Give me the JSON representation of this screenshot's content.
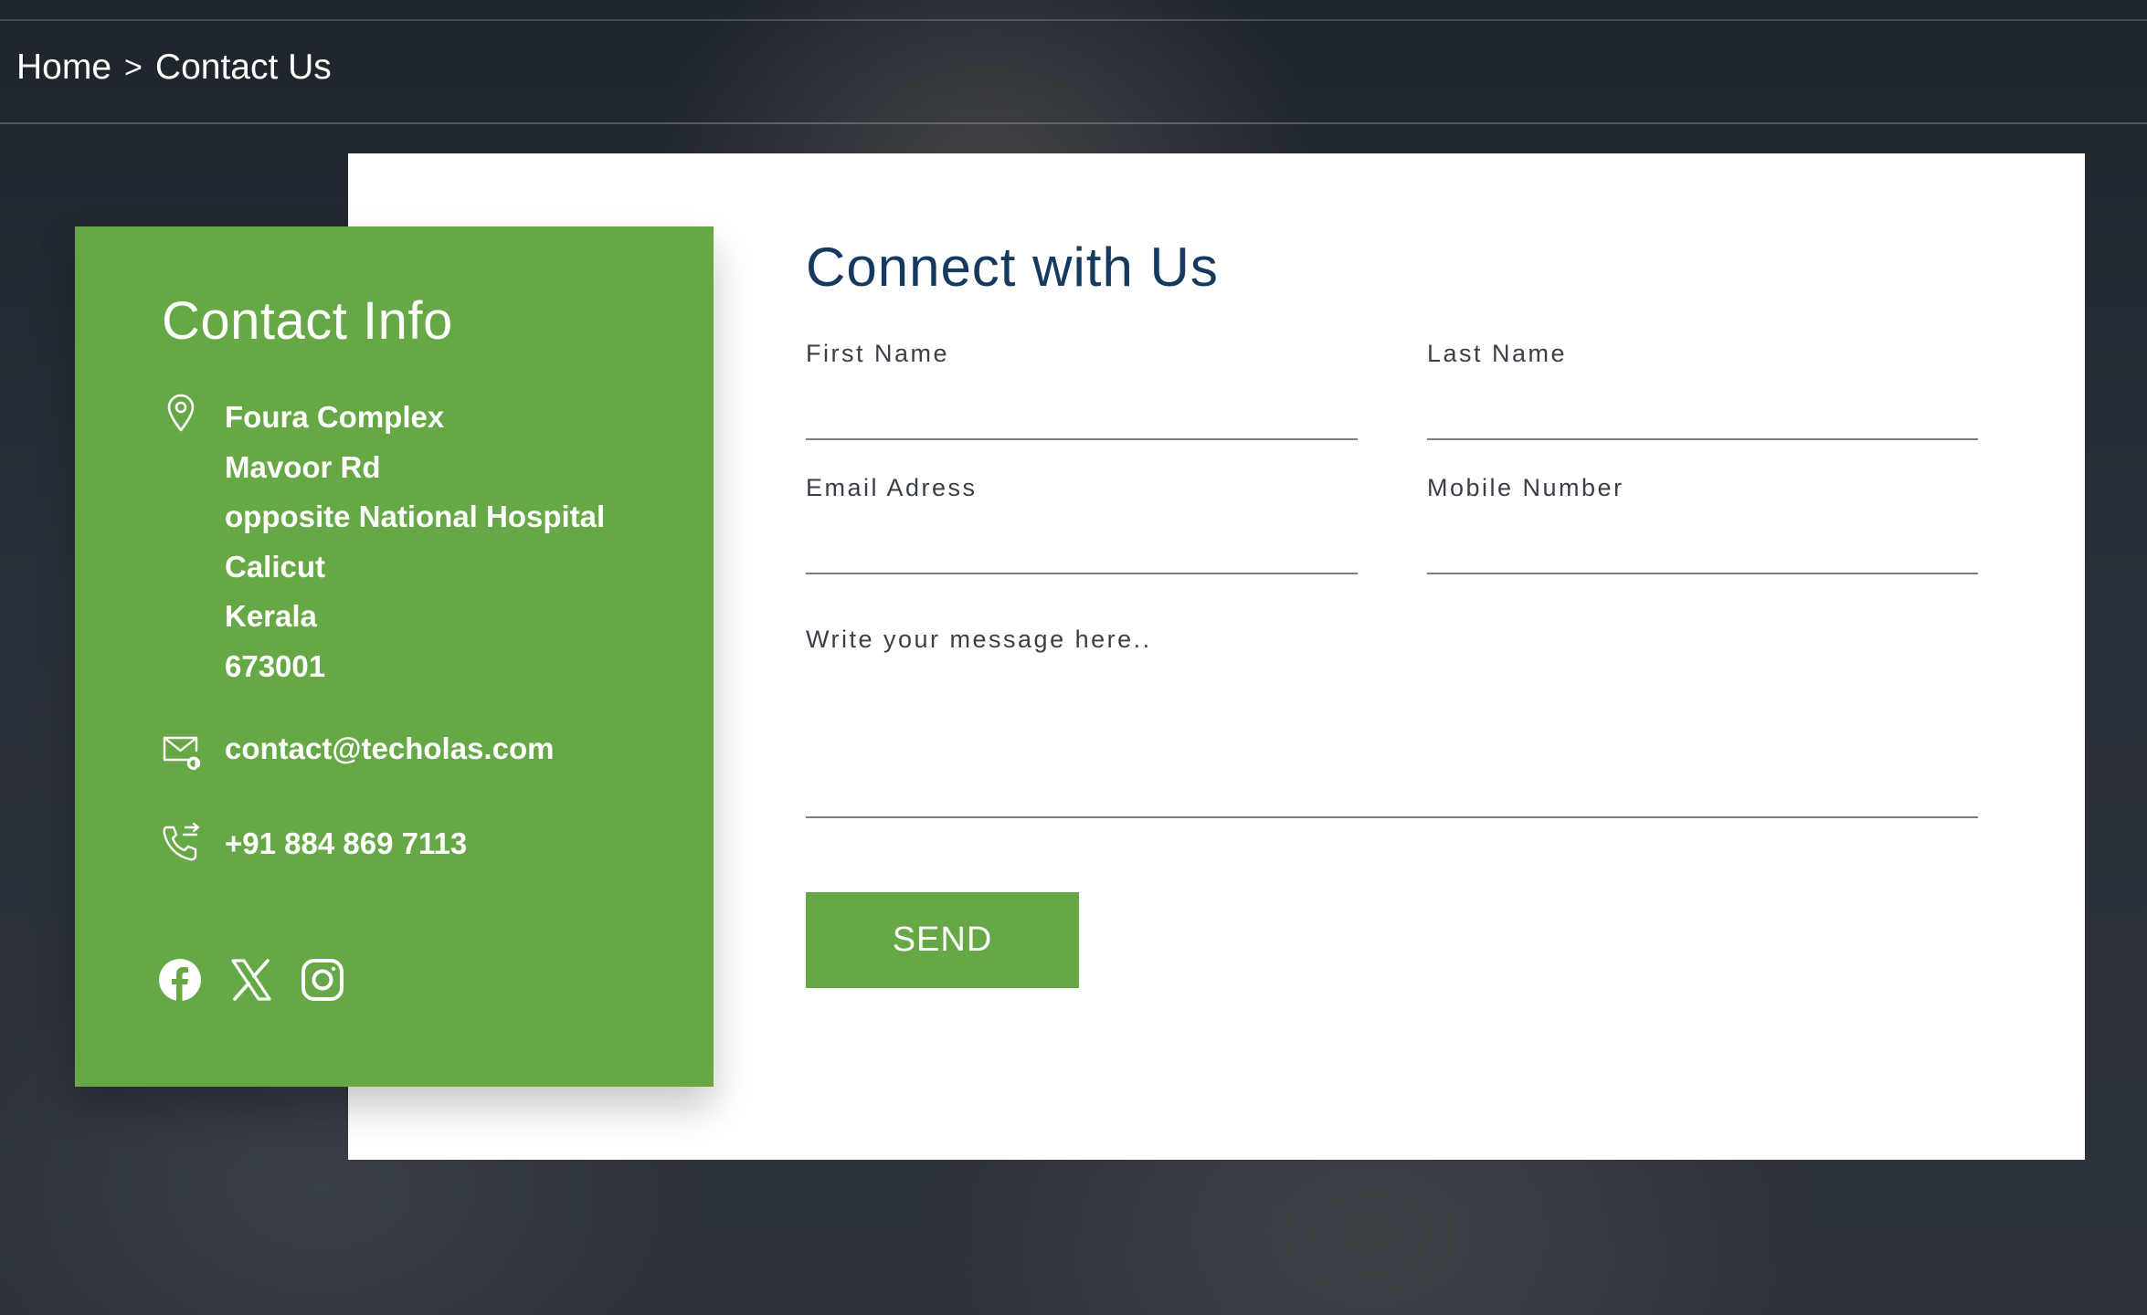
{
  "breadcrumb": {
    "home": "Home",
    "separator": ">",
    "current": "Contact Us"
  },
  "contact_info": {
    "title": "Contact Info",
    "address_lines": [
      "Foura Complex",
      "Mavoor Rd",
      "opposite National Hospital",
      "Calicut",
      "Kerala",
      "673001"
    ],
    "email": "contact@techolas.com",
    "phone": "+91 884 869 7113",
    "icons": [
      "location-pin-icon",
      "mail-icon",
      "phone-icon"
    ],
    "socials": [
      "facebook-icon",
      "x-twitter-icon",
      "instagram-icon"
    ]
  },
  "form": {
    "title": "Connect with Us",
    "first_name_label": "First Name",
    "last_name_label": "Last Name",
    "email_label": "Email Adress",
    "mobile_label": "Mobile Number",
    "message_placeholder": "Write your message here..",
    "send_label": "SEND"
  },
  "colors": {
    "accent_green": "#67a846",
    "title_navy": "#163a5f"
  }
}
